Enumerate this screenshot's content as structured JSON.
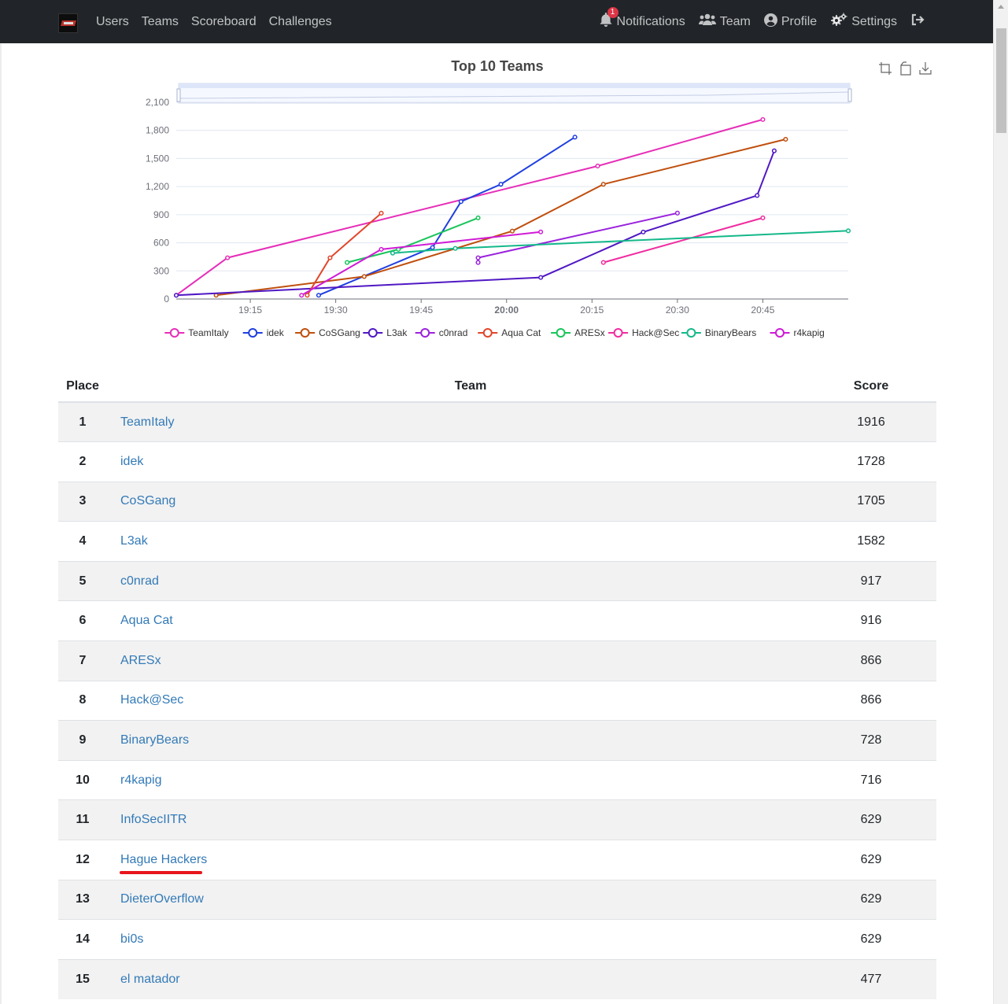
{
  "navbar": {
    "left_links": [
      "Users",
      "Teams",
      "Scoreboard",
      "Challenges"
    ],
    "notifications_label": "Notifications",
    "notification_count": "1",
    "team_label": "Team",
    "profile_label": "Profile",
    "settings_label": "Settings"
  },
  "toolbox": [
    "zoom-icon",
    "zoom-reset-icon",
    "download-icon"
  ],
  "chart_data": {
    "type": "line",
    "title": "Top 10 Teams",
    "xlabel": "",
    "ylabel": "",
    "x_ticks": [
      "19:15",
      "19:30",
      "19:45",
      "20:00",
      "20:15",
      "20:30",
      "20:45"
    ],
    "y_ticks": [
      0,
      300,
      600,
      900,
      1200,
      1500,
      1800,
      2100
    ],
    "ylim": [
      0,
      2100
    ],
    "xlim": [
      "19:02",
      "21:00"
    ],
    "grid": "horizontal",
    "legend_position": "bottom",
    "series": [
      {
        "name": "TeamItaly",
        "color": "#e62eb8",
        "points": [
          [
            "19:02",
            40
          ],
          [
            "19:11",
            440
          ],
          [
            "20:16",
            1420
          ],
          [
            "20:45",
            1916
          ]
        ]
      },
      {
        "name": "idek",
        "color": "#1f3fe0",
        "points": [
          [
            "19:27",
            40
          ],
          [
            "19:47",
            550
          ],
          [
            "19:52",
            1040
          ],
          [
            "19:59",
            1225
          ],
          [
            "20:12",
            1728
          ]
        ]
      },
      {
        "name": "CoSGang",
        "color": "#c04f0d",
        "points": [
          [
            "19:09",
            40
          ],
          [
            "19:35",
            240
          ],
          [
            "20:01",
            725
          ],
          [
            "20:17",
            1225
          ],
          [
            "20:49",
            1705
          ]
        ]
      },
      {
        "name": "L3ak",
        "color": "#5018c4",
        "points": [
          [
            "19:02",
            40
          ],
          [
            "20:06",
            230
          ],
          [
            "20:24",
            715
          ],
          [
            "20:44",
            1105
          ],
          [
            "20:47",
            1582
          ]
        ]
      },
      {
        "name": "c0nrad",
        "color": "#9a22dc",
        "points": [
          [
            "19:55",
            390
          ],
          [
            "19:55",
            440
          ],
          [
            "20:30",
            917
          ]
        ]
      },
      {
        "name": "Aqua Cat",
        "color": "#e2452a",
        "points": [
          [
            "19:25",
            40
          ],
          [
            "19:29",
            440
          ],
          [
            "19:38",
            916
          ]
        ]
      },
      {
        "name": "ARESx",
        "color": "#18c45a",
        "points": [
          [
            "19:32",
            390
          ],
          [
            "19:41",
            530
          ],
          [
            "19:55",
            866
          ]
        ]
      },
      {
        "name": "Hack@Sec",
        "color": "#f02ca0",
        "points": [
          [
            "20:17",
            390
          ],
          [
            "20:45",
            866
          ]
        ]
      },
      {
        "name": "BinaryBears",
        "color": "#14b88a",
        "points": [
          [
            "19:40",
            490
          ],
          [
            "19:51",
            540
          ],
          [
            "21:00",
            728
          ]
        ]
      },
      {
        "name": "r4kapig",
        "color": "#d01ad6",
        "points": [
          [
            "19:24",
            40
          ],
          [
            "19:38",
            530
          ],
          [
            "20:06",
            716
          ]
        ]
      }
    ]
  },
  "table": {
    "headers": {
      "place": "Place",
      "team": "Team",
      "score": "Score"
    },
    "rows": [
      {
        "place": "1",
        "team": "TeamItaly",
        "score": "1916"
      },
      {
        "place": "2",
        "team": "idek",
        "score": "1728"
      },
      {
        "place": "3",
        "team": "CoSGang",
        "score": "1705"
      },
      {
        "place": "4",
        "team": "L3ak",
        "score": "1582"
      },
      {
        "place": "5",
        "team": "c0nrad",
        "score": "917"
      },
      {
        "place": "6",
        "team": "Aqua Cat",
        "score": "916"
      },
      {
        "place": "7",
        "team": "ARESx",
        "score": "866"
      },
      {
        "place": "8",
        "team": "Hack@Sec",
        "score": "866"
      },
      {
        "place": "9",
        "team": "BinaryBears",
        "score": "728"
      },
      {
        "place": "10",
        "team": "r4kapig",
        "score": "716"
      },
      {
        "place": "11",
        "team": "InfoSecIITR",
        "score": "629"
      },
      {
        "place": "12",
        "team": "Hague Hackers",
        "score": "629"
      },
      {
        "place": "13",
        "team": "DieterOverflow",
        "score": "629"
      },
      {
        "place": "14",
        "team": "bi0s",
        "score": "629"
      },
      {
        "place": "15",
        "team": "el matador",
        "score": "477"
      }
    ]
  }
}
